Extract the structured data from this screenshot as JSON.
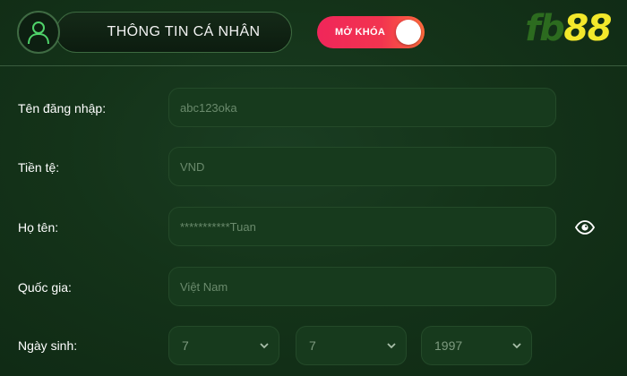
{
  "header": {
    "title": "THÔNG TIN CÁ NHÂN",
    "unlock_label": "MỞ KHÓA",
    "logo_prefix": "fb",
    "logo_number": "88",
    "avatar_icon": "user-icon"
  },
  "colors": {
    "background": "#143319",
    "toggle_start": "#f0265a",
    "toggle_end": "#ff6a3d",
    "logo_green": "#2c6b1f",
    "logo_yellow": "#f3e82b"
  },
  "form": {
    "username": {
      "label": "Tên đăng nhập:",
      "value": "abc123oka"
    },
    "currency": {
      "label": "Tiền tệ:",
      "value": "VND"
    },
    "fullname": {
      "label": "Họ tên:",
      "value": "***********Tuan",
      "reveal_icon": "eye-icon"
    },
    "country": {
      "label": "Quốc gia:",
      "value": "Việt Nam"
    },
    "birthdate": {
      "label": "Ngày sinh:",
      "day": "7",
      "month": "7",
      "year": "1997"
    }
  }
}
